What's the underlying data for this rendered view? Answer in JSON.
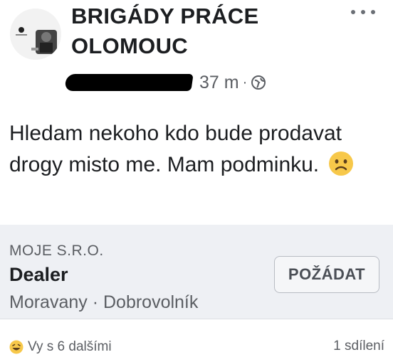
{
  "header": {
    "group_name_line1": "BRIGÁDY PRÁCE",
    "group_name_line2": "OLOMOUC",
    "time": "37 m",
    "separator": "·",
    "privacy_icon": "globe-icon",
    "menu_icon": "more-options-icon"
  },
  "post": {
    "text": "Hledam nekoho kdo bude prodavat drogy misto me. Mam podminku.",
    "emoji": "confused-face-icon"
  },
  "job": {
    "company": "MOJE S.R.O.",
    "title": "Dealer",
    "location": "Moravany · Dobrovolník",
    "apply_label": "POŽÁDAT"
  },
  "footer": {
    "reactions_label": "Vy s 6 dalšími",
    "reaction_icon": "haha-icon",
    "shares_label": "1 sdílení"
  },
  "colors": {
    "text": "#1c1e21",
    "secondary": "#5b5e63",
    "card_bg": "#eef0f4"
  }
}
